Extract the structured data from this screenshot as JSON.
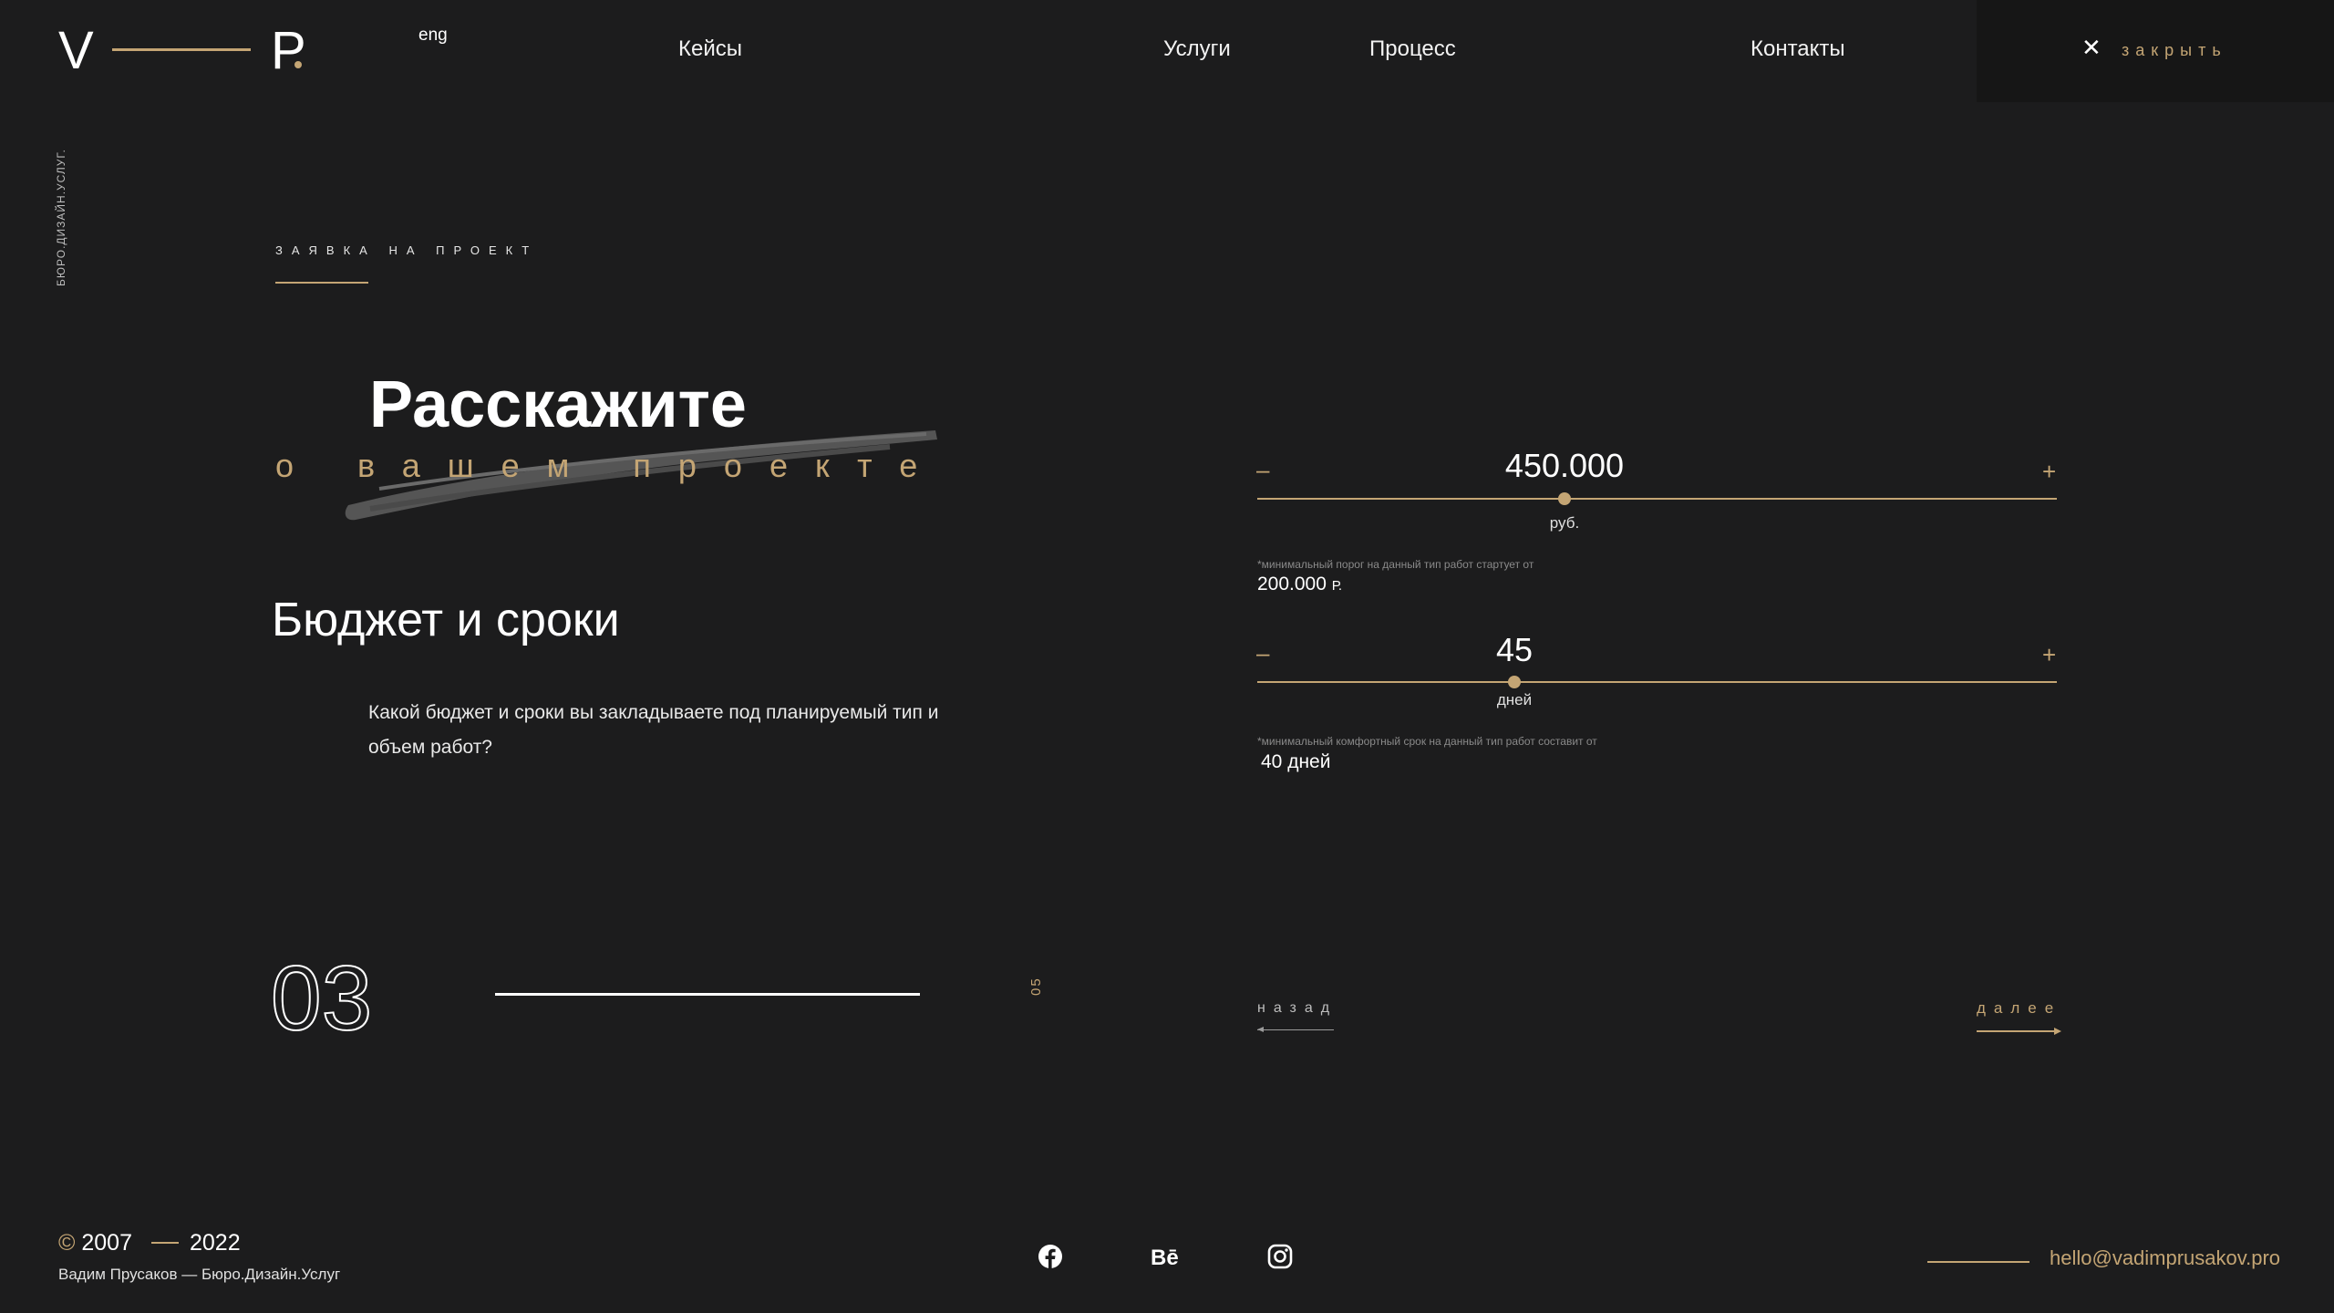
{
  "header": {
    "logo_left": "V",
    "logo_right": "P",
    "lang": "eng",
    "nav": [
      "Кейсы",
      "Услуги",
      "Процесс",
      "Контакты"
    ],
    "close_label": "закрыть",
    "close_icon": "close-icon"
  },
  "sidebar": {
    "tagline": "БЮРО.ДИЗАЙН.УСЛУГ."
  },
  "section": {
    "label": "ЗАЯВКА НА ПРОЕКТ",
    "title": "Расскажите",
    "subtitle": "о вашем проекте",
    "heading": "Бюджет и сроки",
    "description": "Какой бюджет и сроки вы закладываете под планируемый тип и объем работ?"
  },
  "step": {
    "current": "03",
    "total": "05"
  },
  "budget": {
    "minus": "–",
    "plus": "+",
    "value": "450.000",
    "unit": "руб.",
    "note": "*минимальный порог на данный тип работ стартует от",
    "min_value": "200.000",
    "min_unit": "Р."
  },
  "timeline": {
    "minus": "–",
    "plus": "+",
    "value": "45",
    "unit": "дней",
    "note": "*минимальный комфортный срок на данный тип работ составит от",
    "min_value": "40 дней"
  },
  "navigation": {
    "back": "назад",
    "next": "далее"
  },
  "footer": {
    "copyright_symbol": "©",
    "year_from": "2007",
    "year_to": "2022",
    "author": "Вадим Прусаков",
    "dash": "—",
    "bureau": "Бюро.Дизайн.Услуг",
    "email": "hello@vadimprusakov.pro",
    "social_icons": [
      "facebook-icon",
      "behance-icon",
      "instagram-icon"
    ]
  },
  "colors": {
    "background": "#1c1c1d",
    "accent": "#c4a574",
    "panel": "#161616"
  }
}
